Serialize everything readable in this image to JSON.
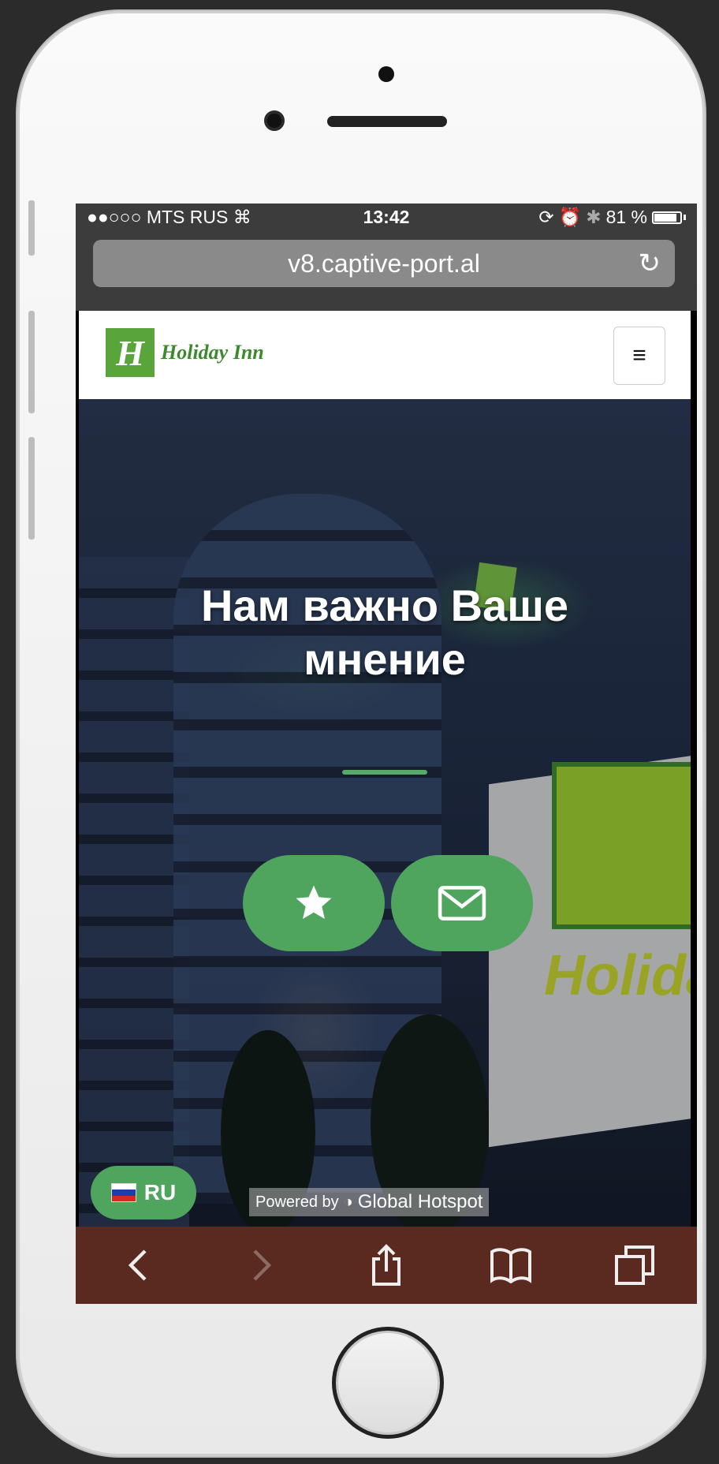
{
  "status_bar": {
    "carrier": "●●○○○ MTS RUS",
    "time": "13:42",
    "battery": "81 %",
    "battery_level": 0.81
  },
  "browser": {
    "url": "v8.captive-port.al"
  },
  "site": {
    "brand": "Holiday Inn",
    "logo_mark": "H"
  },
  "hero": {
    "headline_line1": "Нам важно Ваше",
    "headline_line2": "мнение",
    "sign_text": "Holida"
  },
  "language": {
    "code": "RU"
  },
  "footer": {
    "powered_prefix": "Powered by",
    "powered_brand": "Global Hotspot"
  },
  "colors": {
    "accent_green": "#4fa55e",
    "toolbar_brown": "#5a2a20"
  }
}
